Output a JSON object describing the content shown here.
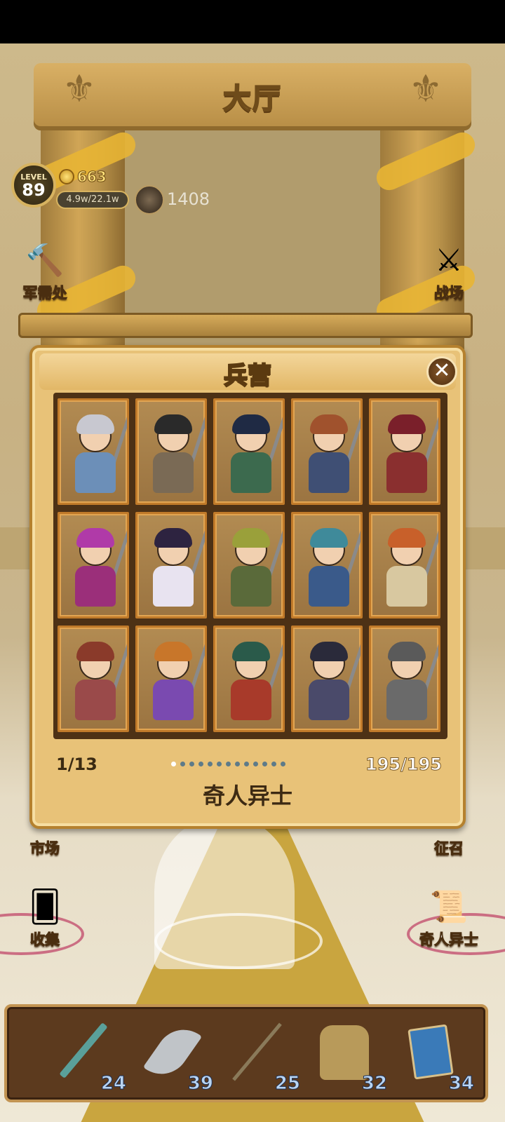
{
  "hall": {
    "title": "大厅"
  },
  "hud": {
    "level_label": "LEVEL",
    "level": "89",
    "gold": "663",
    "exp": "4.9w/22.1w",
    "power": "1408"
  },
  "side_buttons": {
    "supply": "军需处",
    "battlefield": "战场",
    "market": "市场",
    "recruit": "征召",
    "collect": "收集",
    "strangers": "奇人异士"
  },
  "panel": {
    "title": "兵营",
    "close_icon": "close-icon",
    "page": "1/13",
    "dot_count": 13,
    "capacity": "195/195",
    "category": "奇人异士",
    "heroes": [
      {
        "hair": "#c8c8d0",
        "body": "#6c8fb8"
      },
      {
        "hair": "#2a2a2a",
        "body": "#7a6a55"
      },
      {
        "hair": "#1f2a44",
        "body": "#3c6a4e"
      },
      {
        "hair": "#a0522d",
        "body": "#3f4f74"
      },
      {
        "hair": "#7a1f2a",
        "body": "#8a2f2f"
      },
      {
        "hair": "#b03aa8",
        "body": "#9b2f7a"
      },
      {
        "hair": "#2d2340",
        "body": "#e8e3f0"
      },
      {
        "hair": "#9aa03a",
        "body": "#5a6a3a"
      },
      {
        "hair": "#3f8a9a",
        "body": "#3a5a8a"
      },
      {
        "hair": "#c8602a",
        "body": "#d8c8a0"
      },
      {
        "hair": "#8a3a2a",
        "body": "#9a4a4a"
      },
      {
        "hair": "#c8762a",
        "body": "#7a4ab0"
      },
      {
        "hair": "#2a5a4a",
        "body": "#a83a2a"
      },
      {
        "hair": "#2a2a3a",
        "body": "#4a4a6a"
      },
      {
        "hair": "#5a5a5a",
        "body": "#6a6a6a"
      }
    ]
  },
  "equipment": [
    {
      "name": "sword-icon",
      "count": "24",
      "color": "#5aa09a"
    },
    {
      "name": "blade-icon",
      "count": "39",
      "color": "#c0c4c8"
    },
    {
      "name": "spear-icon",
      "count": "25",
      "color": "#8a7a5a"
    },
    {
      "name": "armor-icon",
      "count": "32",
      "color": "#b89a5a"
    },
    {
      "name": "book-icon",
      "count": "34",
      "color": "#3a7ab8"
    }
  ],
  "colors": {
    "accent": "#e8c278",
    "frame": "#b5812e",
    "bar": "#5c3a1e"
  }
}
